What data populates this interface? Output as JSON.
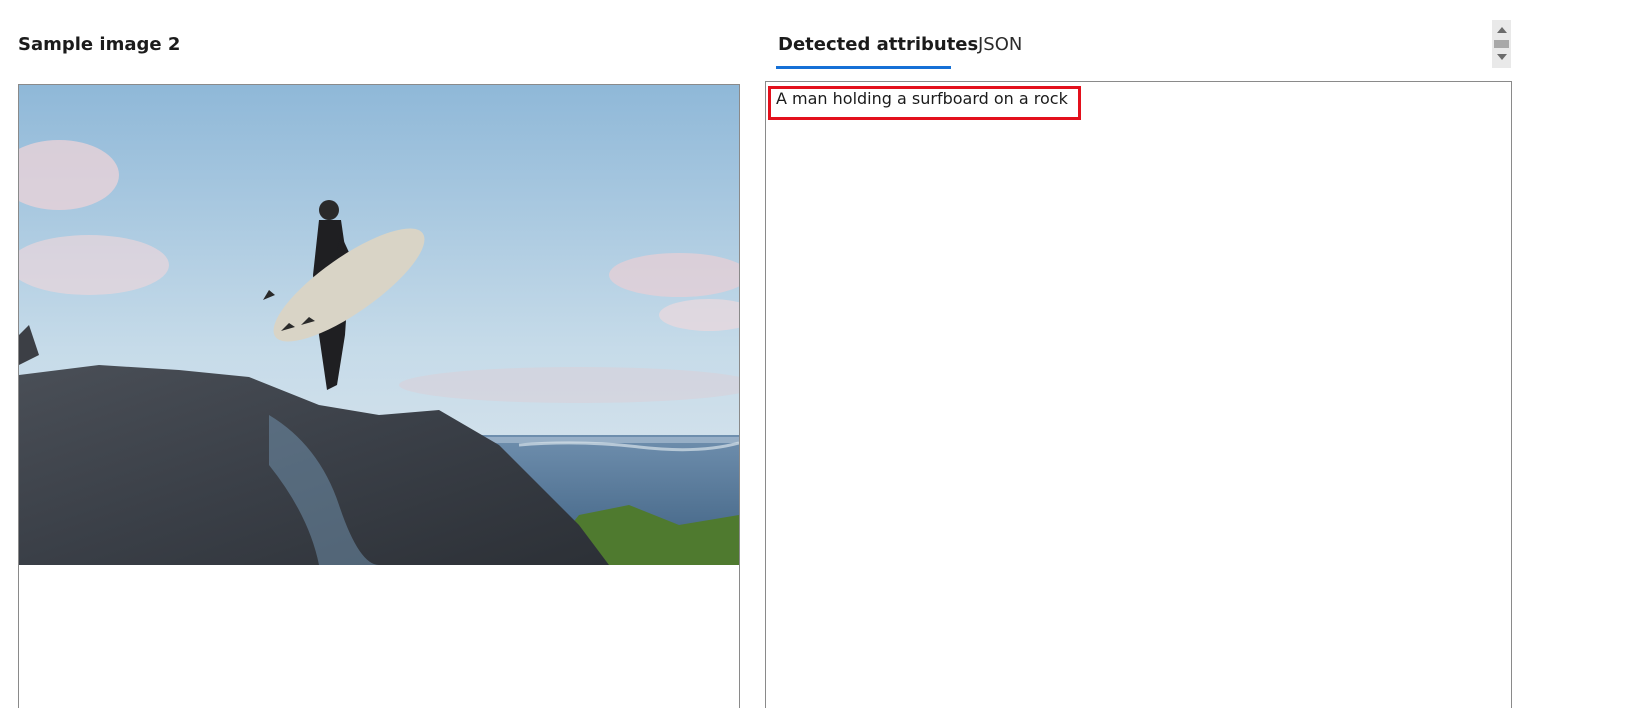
{
  "sample": {
    "title": "Sample image 2"
  },
  "tabs": [
    {
      "label": "Detected attributes",
      "active": true
    },
    {
      "label": "JSON",
      "active": false
    }
  ],
  "results": {
    "caption": "A man holding a surfboard on a rock"
  },
  "colors": {
    "accent": "#1570d6",
    "highlight": "#e3101c"
  }
}
